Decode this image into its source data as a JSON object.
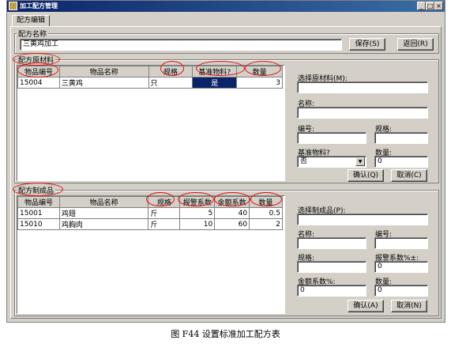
{
  "window": {
    "title": "加工配方管理",
    "controls": [
      "_",
      "□",
      "×"
    ]
  },
  "tabs": [
    {
      "label": "配方编辑"
    }
  ],
  "recipe_name": {
    "label": "配方名称",
    "value": "三黄鸡加工"
  },
  "buttons": {
    "save": "保存(S)",
    "back": "返回(R)"
  },
  "materials": {
    "group_label": "配方原材料",
    "headers": [
      "物品编号",
      "物品名称",
      "规格",
      "基准物料?",
      "数量"
    ],
    "rows": [
      {
        "code": "15004",
        "name": "三黄鸡",
        "spec": "只",
        "base": "是",
        "qty": "3"
      }
    ]
  },
  "material_form": {
    "select_label": "选择原材料(M):",
    "name_label": "名称:",
    "code_label": "编号:",
    "spec_label": "规格:",
    "base_label": "基准物料?",
    "base_value": "否",
    "qty_label": "数量:",
    "qty_value": "0",
    "confirm": "确认(Q)",
    "cancel": "取消(C)"
  },
  "products": {
    "group_label": "配方制成品",
    "headers": [
      "物品编号",
      "物品名称",
      "规格",
      "报警系数",
      "金额系数",
      "数量"
    ],
    "rows": [
      {
        "code": "15001",
        "name": "鸡翅",
        "spec": "斤",
        "alarm": "5",
        "amount": "40",
        "qty": "0.5"
      },
      {
        "code": "15010",
        "name": "鸡胸肉",
        "spec": "斤",
        "alarm": "10",
        "amount": "60",
        "qty": "2"
      }
    ]
  },
  "product_form": {
    "select_label": "选择制成品(P):",
    "name_label": "名称:",
    "code_label": "编号:",
    "spec_label": "规格:",
    "alarm_label": "报警系数%±:",
    "alarm_value": "0",
    "amount_label": "金额系数%:",
    "amount_value": "0",
    "qty_label": "数量:",
    "qty_value": "0",
    "confirm": "确认(A)",
    "cancel": "取消(N)"
  },
  "caption": "图 F44 设置标准加工配方表",
  "colors": {
    "titlebar": "#0a246a",
    "selection": "#0a246a",
    "annotation_ring": "#e01010",
    "face": "#d4d0c8"
  }
}
